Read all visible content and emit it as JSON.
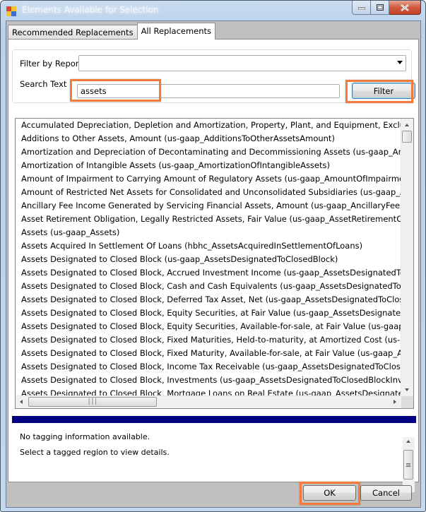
{
  "window": {
    "title": "Elements Available for Selection",
    "icon": "app-window-icon",
    "controls": {
      "minimize": "minimize-icon",
      "maximize": "maximize-icon",
      "close": "close-icon"
    }
  },
  "tabs": [
    {
      "label": "Recommended Replacements",
      "active": false
    },
    {
      "label": "All Replacements",
      "active": true
    }
  ],
  "filters": {
    "report_label": "Filter by Report",
    "report_selected": "",
    "search_label": "Search Text",
    "search_value": "assets",
    "search_placeholder": "",
    "filter_button": "Filter"
  },
  "elements_list": [
    "Accumulated Depreciation, Depletion and Amortization, Property, Plant, and Equipment, Excluding Capital Leases (us-gaap_AccumulatedDepreciationDepletionAndAmortizationPropertyPlantAndEquipment)",
    "Additions to Other Assets, Amount (us-gaap_AdditionsToOtherAssetsAmount)",
    "Amortization and Depreciation of Decontaminating and Decommissioning Assets (us-gaap_AmortizationAndDepreciationOfDecontaminatingAndDecommissioningAssets)",
    "Amortization of Intangible Assets (us-gaap_AmortizationOfIntangibleAssets)",
    "Amount of Impairment to Carrying Amount of Regulatory Assets (us-gaap_AmountOfImpairmentToCarryingAmountOfRegulatoryAssets)",
    "Amount of Restricted Net Assets for Consolidated and Unconsolidated Subsidiaries (us-gaap_AmountOfRestrictedNetAssetsForConsolidatedAndUnconsolidatedSubsidiaries)",
    "Ancillary Fee Income Generated by Servicing Financial Assets, Amount (us-gaap_AncillaryFeeIncomeGeneratedByServicingFinancialAssetsAmount)",
    "Asset Retirement Obligation, Legally Restricted Assets, Fair Value (us-gaap_AssetRetirementObligationLegallyRestrictedAssetsFairValue)",
    "Assets (us-gaap_Assets)",
    "Assets Acquired In Settlement Of Loans (hbhc_AssetsAcquiredInSettlementOfLoans)",
    "Assets Designated to Closed Block (us-gaap_AssetsDesignatedToClosedBlock)",
    "Assets Designated to Closed Block, Accrued Investment Income (us-gaap_AssetsDesignatedToClosedBlockAccruedInvestmentIncome)",
    "Assets Designated to Closed Block, Cash and Cash Equivalents (us-gaap_AssetsDesignatedToClosedBlockCashAndCashEquivalents)",
    "Assets Designated to Closed Block, Deferred Tax Asset, Net (us-gaap_AssetsDesignatedToClosedBlockDeferredTaxAssetNet)",
    "Assets Designated to Closed Block, Equity Securities, at Fair Value (us-gaap_AssetsDesignatedToClosedBlockEquitySecuritiesAtFairValue)",
    "Assets Designated to Closed Block, Equity Securities, Available-for-sale, at Fair Value (us-gaap_AssetsDesignatedToClosedBlockEquitySecuritiesAvailableForSale)",
    "Assets Designated to Closed Block, Fixed Maturities, Held-to-maturity, at Amortized Cost (us-gaap_AssetsDesignatedToClosedBlockFixedMaturitiesHeldToMaturity)",
    "Assets Designated to Closed Block, Fixed Maturity, Available-for-sale, at Fair Value (us-gaap_AssetsDesignatedToClosedBlockFixedMaturityAvailableForSale)",
    "Assets Designated to Closed Block, Income Tax Receivable (us-gaap_AssetsDesignatedToClosedBlockIncomeTaxReceivable)",
    "Assets Designated to Closed Block, Investments (us-gaap_AssetsDesignatedToClosedBlockInvestments)",
    "Assets Designated to Closed Block, Mortgage Loans on Real Estate (us-gaap_AssetsDesignatedToClosedBlockMortgageLoansOnRealEstate)"
  ],
  "details": {
    "line1": "No tagging information available.",
    "line2": "Select a tagged region to view details."
  },
  "footer": {
    "ok_button": "OK",
    "cancel_button": "Cancel"
  },
  "colors": {
    "highlight": "#f47a3a",
    "divider": "#000080"
  }
}
